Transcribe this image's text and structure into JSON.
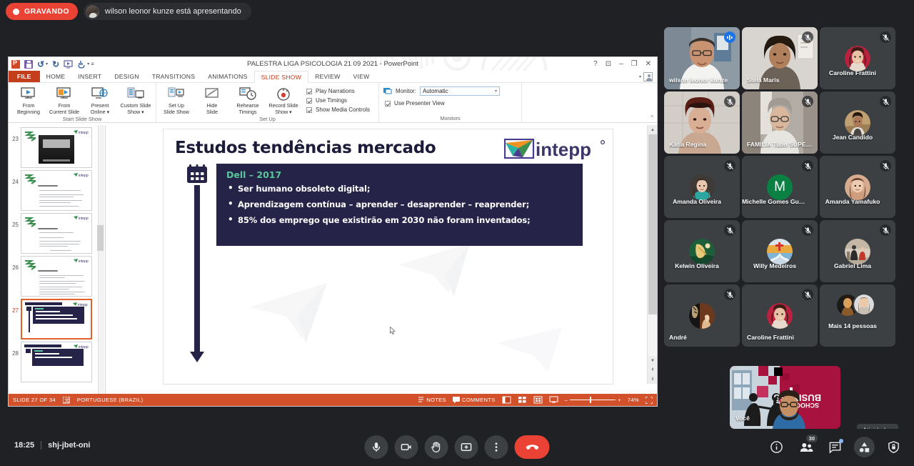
{
  "topbar": {
    "recording_label": "GRAVANDO",
    "presenting_text": "wilson leonor kunze está apresentando"
  },
  "powerpoint": {
    "window_title": "PALESTRA LIGA PSICOLOGIA 21 09 2021 - PowerPoint",
    "quick_access": [
      "powerpoint-icon",
      "save-icon",
      "undo-icon",
      "redo-icon",
      "from-beginning-icon",
      "touch-mode-icon",
      "customize-icon"
    ],
    "window_buttons": [
      "?",
      "⊡",
      "–",
      "❐",
      "✕"
    ],
    "tabs": [
      {
        "label": "FILE",
        "state": "file"
      },
      {
        "label": "HOME",
        "state": "normal"
      },
      {
        "label": "INSERT",
        "state": "normal"
      },
      {
        "label": "DESIGN",
        "state": "normal"
      },
      {
        "label": "TRANSITIONS",
        "state": "normal"
      },
      {
        "label": "ANIMATIONS",
        "state": "normal"
      },
      {
        "label": "SLIDE SHOW",
        "state": "active"
      },
      {
        "label": "REVIEW",
        "state": "normal"
      },
      {
        "label": "VIEW",
        "state": "normal"
      }
    ],
    "ribbon": {
      "groups": [
        {
          "label": "Start Slide Show",
          "buttons": [
            {
              "line1": "From",
              "line2": "Beginning"
            },
            {
              "line1": "From",
              "line2": "Current Slide"
            },
            {
              "line1": "Present",
              "line2": "Online ▾"
            },
            {
              "line1": "Custom Slide",
              "line2": "Show ▾"
            }
          ]
        },
        {
          "label": "Set Up",
          "buttons": [
            {
              "line1": "Set Up",
              "line2": "Slide Show"
            },
            {
              "line1": "Hide",
              "line2": "Slide"
            },
            {
              "line1": "Rehearse",
              "line2": "Timings"
            },
            {
              "line1": "Record Slide",
              "line2": "Show ▾"
            }
          ],
          "checkboxes": [
            {
              "label": "Play Narrations",
              "checked": true
            },
            {
              "label": "Use Timings",
              "checked": true
            },
            {
              "label": "Show Media Controls",
              "checked": true
            }
          ]
        },
        {
          "label": "Monitors",
          "monitor_label": "Monitor:",
          "monitor_value": "Automatic",
          "presenter_view": {
            "label": "Use Presenter View",
            "checked": true
          }
        }
      ]
    },
    "thumbnails": [
      {
        "number": "23",
        "kind": "photo"
      },
      {
        "number": "24",
        "kind": "text",
        "lines": 6
      },
      {
        "number": "25",
        "kind": "text",
        "lines": 5
      },
      {
        "number": "26",
        "kind": "text",
        "lines": 6
      },
      {
        "number": "27",
        "kind": "dark",
        "selected": true
      },
      {
        "number": "28",
        "kind": "dark"
      }
    ],
    "slide": {
      "title": "Estudos tendências mercado",
      "logo_text": "intepp",
      "box_heading": "Dell – 2017",
      "bullets": [
        "Ser humano obsoleto digital;",
        "Aprendizagem contínua – aprender – desaprender – reaprender;",
        "85% dos emprego que existirão em 2030 não foram inventados;"
      ]
    },
    "status": {
      "slide_counter": "SLIDE 27 OF 34",
      "language": "PORTUGUESE (BRAZIL)",
      "notes_label": "NOTES",
      "comments_label": "COMMENTS",
      "zoom_level": "74%"
    }
  },
  "tiles": [
    [
      {
        "name": "wilson leonor kunze",
        "type": "video",
        "muted": false,
        "speaking": true,
        "active": true,
        "bg": "office"
      },
      {
        "name": "Stela Maris",
        "type": "video",
        "muted": true,
        "bg": "room1"
      },
      {
        "name": "Caroline Frattini",
        "type": "avatar",
        "muted": true,
        "avatar": "woman-red",
        "centered": true
      }
    ],
    [
      {
        "name": "Kátia Regina",
        "type": "video",
        "muted": true,
        "bg": "room2"
      },
      {
        "name": "FAMILIA Tubo SUPER...",
        "type": "video",
        "muted": true,
        "bg": "room3"
      },
      {
        "name": "Jean Candido",
        "type": "avatar",
        "muted": true,
        "avatar": "man-tan",
        "centered": true
      }
    ],
    [
      {
        "name": "Amanda Oliveira",
        "type": "avatar",
        "muted": true,
        "avatar": "woman-teal",
        "centered": true
      },
      {
        "name": "Michelle Gomes Guer...",
        "type": "initial",
        "initial": "M",
        "muted": true,
        "color": "#0b8043",
        "centered": true
      },
      {
        "name": "Amanda Yamafuko",
        "type": "avatar",
        "muted": true,
        "avatar": "woman-peach",
        "centered": true
      }
    ],
    [
      {
        "name": "Kelwin Oliveira",
        "type": "avatar",
        "muted": true,
        "avatar": "green-scene",
        "centered": true
      },
      {
        "name": "Willy Medeiros",
        "type": "avatar",
        "muted": true,
        "avatar": "mountain",
        "centered": true
      },
      {
        "name": "Gabriel Lima",
        "type": "avatar",
        "muted": true,
        "avatar": "group-photo",
        "centered": true
      }
    ],
    [
      {
        "name": "André",
        "type": "avatar",
        "muted": true,
        "avatar": "dark-art"
      },
      {
        "name": "Caroline Frattini",
        "type": "avatar",
        "muted": true,
        "avatar": "woman-red"
      },
      {
        "name": "Mais 14 pessoas",
        "type": "overflow",
        "muted": false,
        "centered": true
      }
    ]
  ],
  "selfview": {
    "name": "Você"
  },
  "tooltip": {
    "text": "Atividades"
  },
  "bottombar": {
    "time": "18:25",
    "meeting_code": "shj-jbet-oni",
    "controls": [
      {
        "name": "microphone-button",
        "icon": "mic"
      },
      {
        "name": "camera-button",
        "icon": "cam"
      },
      {
        "name": "raise-hand-button",
        "icon": "hand"
      },
      {
        "name": "present-screen-button",
        "icon": "present"
      },
      {
        "name": "more-options-button",
        "icon": "dots"
      },
      {
        "name": "leave-call-button",
        "icon": "hangup"
      }
    ],
    "right_controls": [
      {
        "name": "meeting-details-button",
        "icon": "info"
      },
      {
        "name": "participants-button",
        "icon": "people",
        "badge": "30"
      },
      {
        "name": "chat-button",
        "icon": "chat",
        "dot": true
      },
      {
        "name": "activities-button",
        "icon": "activities",
        "selected": true
      },
      {
        "name": "host-controls-button",
        "icon": "shield"
      }
    ]
  },
  "colors": {
    "accent_red": "#ea4335",
    "accent_blue": "#8ab4f8",
    "ppt_orange": "#d2502a",
    "slide_navy": "#262349",
    "slide_green": "#59c79a"
  }
}
